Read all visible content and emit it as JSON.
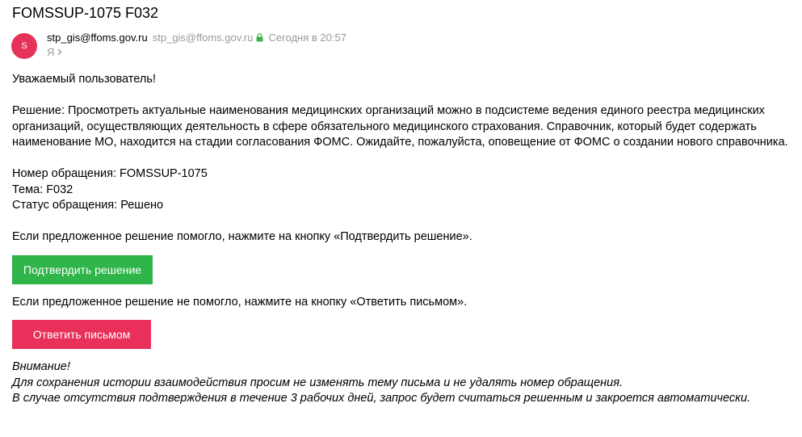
{
  "email": {
    "subject": "FOMSSUP-1075 F032",
    "avatar_letter": "S",
    "avatar_color": "#e6335a",
    "from_name": "stp_gis@ffoms.gov.ru",
    "from_email": "stp_gis@ffoms.gov.ru",
    "date": "Сегодня в 20:57",
    "to": "Я",
    "icons": [
      "lock-icon",
      "chevron-right-icon"
    ]
  },
  "body": {
    "greeting": "Уважаемый пользователь!",
    "solution": "Решение: Просмотреть актуальные наименования медицинских организаций можно в подсистеме ведения единого реестра медицинских организаций, осуществляющих деятельность в сфере обязательного медицинского страхования. Справочник, который будет содержать наименование МО, находится на стадии согласования ФОМС. Ожидайте, пожалуйста, оповещение от ФОМС о создании нового справочника.",
    "ticket_number": "Номер обращения: FOMSSUP-1075",
    "topic": "Тема: F032",
    "status": "Статус обращения: Решено",
    "confirm_prompt": "Если предложенное решение помогло, нажмите на кнопку «Подтвердить решение».",
    "confirm_button": "Подтвердить решение",
    "reply_prompt": "Если предложенное решение не помогло, нажмите на кнопку «Ответить письмом».",
    "reply_button": "Ответить письмом",
    "attention": "Внимание!",
    "note_1": "Для сохранения истории взаимодействия просим не изменять тему письма и не удалять номер обращения.",
    "note_2": "В случае отсутствия подтверждения в течение 3 рабочих дней, запрос будет считаться решенным и закроется автоматически."
  },
  "colors": {
    "confirm": "#2fb54a",
    "reply": "#e8305a",
    "muted": "#999999",
    "lock": "#3cb34a"
  }
}
